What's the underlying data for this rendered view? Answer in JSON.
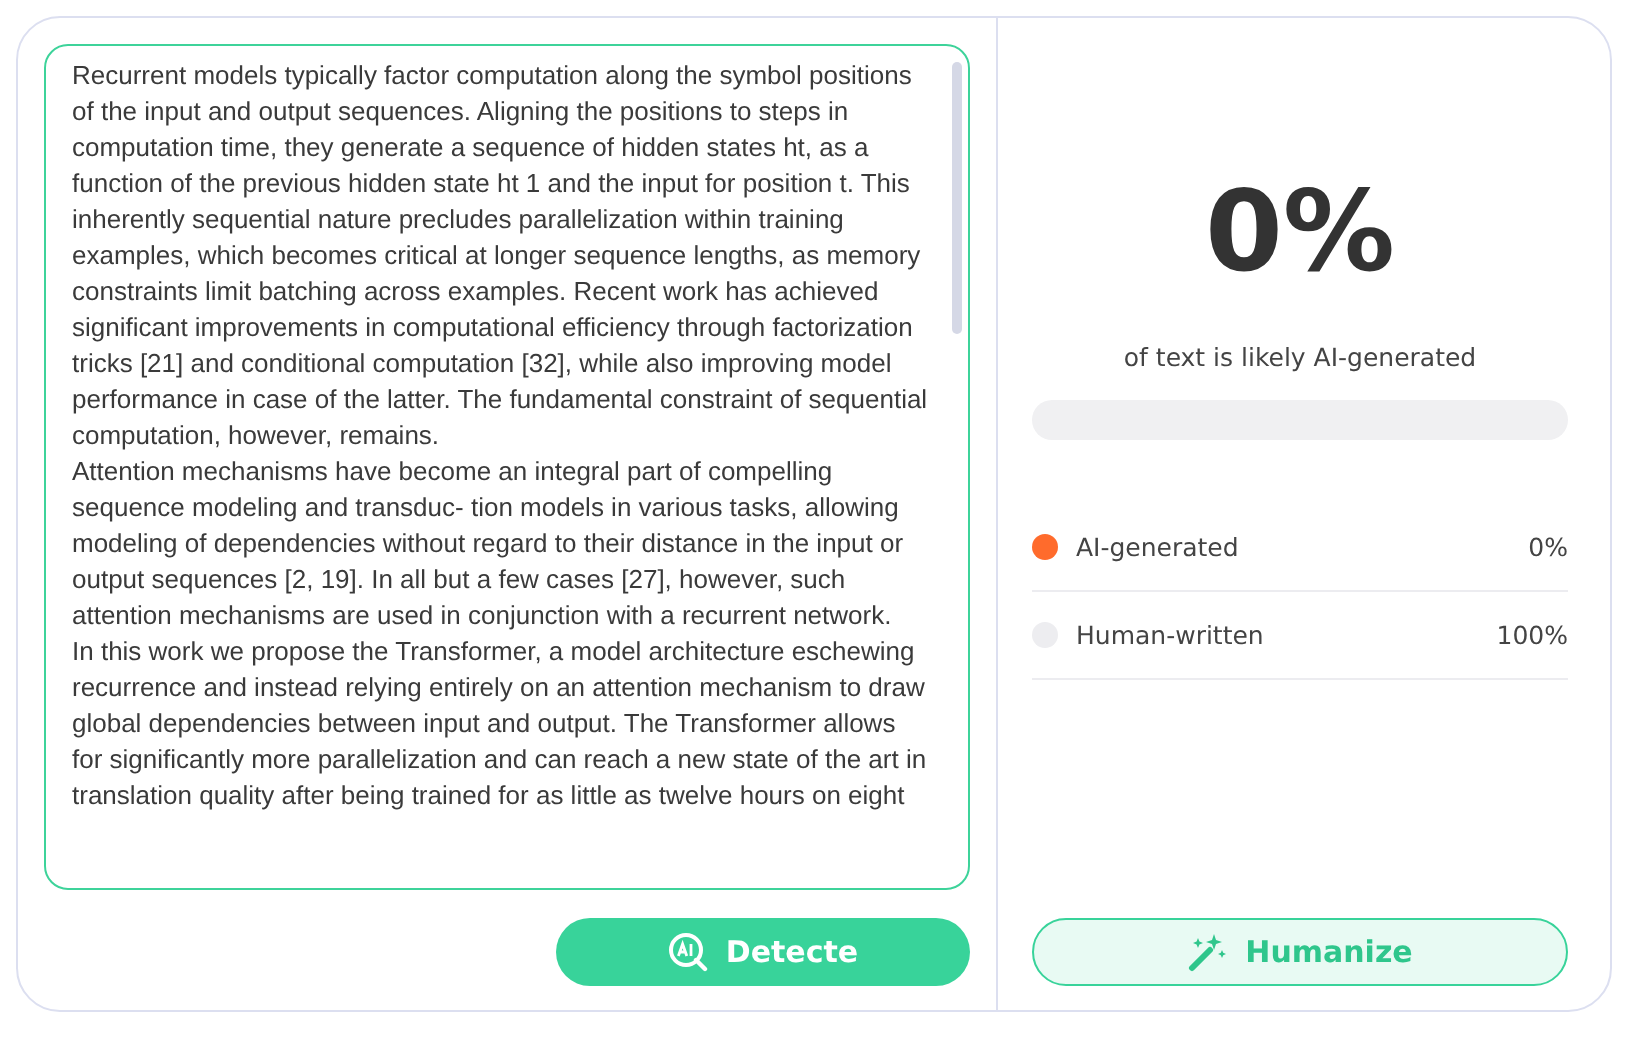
{
  "editor": {
    "paragraphs": [
      "Recurrent models typically factor computation along the symbol positions of the input and output sequences. Aligning the positions to steps in computation time, they generate a sequence of hidden states ht, as a function of the previous hidden state ht  1 and the input for position t. This inherently sequential nature precludes parallelization within training examples, which becomes critical at longer sequence lengths, as memory constraints limit batching across examples. Recent work has achieved significant improvements in computational efficiency through factorization tricks [21] and conditional computation [32], while also improving model performance in case of the latter. The fundamental constraint of sequential computation, however, remains.",
      "Attention mechanisms have become an integral part of compelling sequence modeling and transduc- tion models in various tasks, allowing modeling of dependencies without regard to their distance in the input or output sequences [2, 19]. In all but a few cases [27], however, such attention mechanisms are used in conjunction with a recurrent network.",
      "In this work we propose the Transformer, a model architecture eschewing recurrence and instead relying entirely on an attention mechanism to draw global dependencies between input and output. The Transformer allows for significantly more parallelization and can reach a new state of the art in translation quality after being trained for as little as twelve hours on eight"
    ]
  },
  "detect_button": {
    "label": "Detecte"
  },
  "result": {
    "score": "0%",
    "caption": "of text is likely AI-generated",
    "meter": {
      "level": 0
    },
    "legend": [
      {
        "label": "AI-generated",
        "value": "0%",
        "color": "#ff6b2c"
      },
      {
        "label": "Human-written",
        "value": "100%",
        "color": "#ededf0"
      }
    ]
  },
  "humanize_button": {
    "label": "Humanize"
  }
}
